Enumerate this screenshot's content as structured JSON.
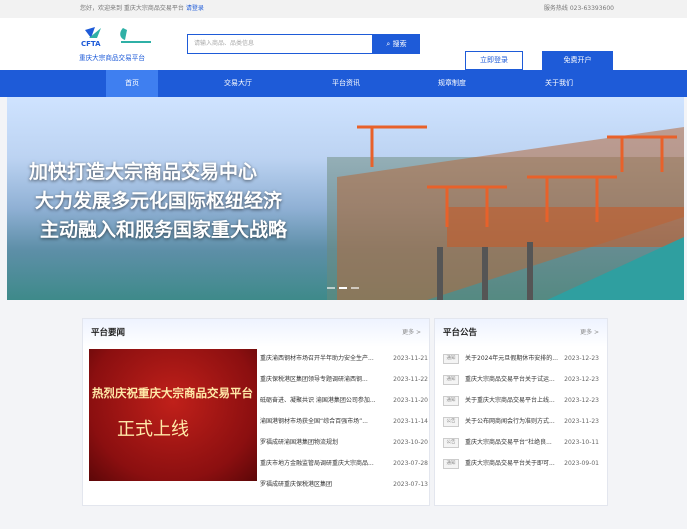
{
  "topbar": {
    "welcome": "您好，欢迎来到 重庆大宗商品交易平台",
    "login_link": "请登录",
    "hotline": "服务热线 023-63393600"
  },
  "logo": {
    "name": "重庆大宗商品交易平台",
    "mark_text": "CFTA"
  },
  "search": {
    "placeholder": "请输入商品、品类信息",
    "button": "搜索"
  },
  "buttons": {
    "login": "立即登录",
    "open": "免费开户"
  },
  "nav": [
    "首页",
    "交易大厅",
    "平台资讯",
    "规章制度",
    "关于我们"
  ],
  "banner": {
    "line1": "加快打造大宗商品交易中心",
    "line2": "大力发展多元化国际枢纽经济",
    "line3": "主动融入和服务国家重大战略"
  },
  "news": {
    "title": "平台要闻",
    "more": "更多 >",
    "image_line1": "热烈庆祝重庆大宗商品交易平台",
    "image_line2": "正式上线",
    "items": [
      {
        "title": "重庆渝西钢材市场召开半年助力安全生产...",
        "date": "2023-11-21"
      },
      {
        "title": "重庆保税港区集团领导专题调研渝西钢...",
        "date": "2023-11-22"
      },
      {
        "title": "砥砺奋进、凝聚共识 渝国港集团公司参加...",
        "date": "2023-11-20"
      },
      {
        "title": "渝国港钢材市场获全国“综合百强市场”...",
        "date": "2023-11-14"
      },
      {
        "title": "罗福成研渝国港集团物流规划",
        "date": "2023-10-20"
      },
      {
        "title": "重庆市地方金融监管局调研重庆大宗商品...",
        "date": "2023-07-28"
      },
      {
        "title": "罗福成研重庆保税港区集团",
        "date": "2023-07-13"
      }
    ]
  },
  "notice": {
    "title": "平台公告",
    "more": "更多 >",
    "items": [
      {
        "tag": "通知",
        "title": "关于2024年元旦假期休市安排的...",
        "date": "2023-12-23"
      },
      {
        "tag": "通知",
        "title": "重庆大宗商品交易平台关于试运...",
        "date": "2023-12-23"
      },
      {
        "tag": "通知",
        "title": "关于重庆大宗商品交易平台上线...",
        "date": "2023-12-23"
      },
      {
        "tag": "公告",
        "title": "关于公布网商闻会行为准则方式...",
        "date": "2023-11-23"
      },
      {
        "tag": "公告",
        "title": "重庆大宗商品交易平台“杜绝良...",
        "date": "2023-10-11"
      },
      {
        "tag": "通知",
        "title": "重庆大宗商品交易平台关于即可...",
        "date": "2023-09-01"
      }
    ]
  },
  "colors": {
    "brand": "#1e5bd8",
    "active_nav": "#3f7ff0"
  }
}
